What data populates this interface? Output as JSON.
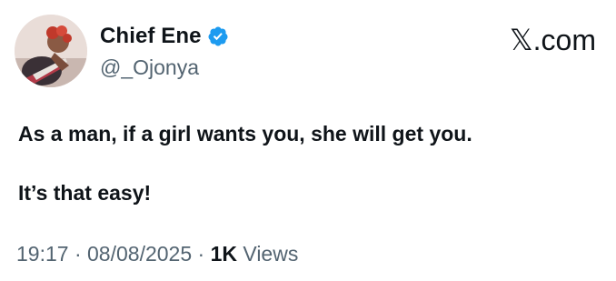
{
  "user": {
    "display_name": "Chief Ene",
    "handle": "@_Ojonya",
    "verified_icon": "verified-badge-icon",
    "avatar_icon": "avatar-photo"
  },
  "brand": {
    "label": "𝕏.com"
  },
  "tweet": {
    "line1": "As a man, if a girl wants you, she will get you.",
    "line2": "It’s that easy!"
  },
  "meta": {
    "time": "19:17",
    "sep1": " · ",
    "date": "08/08/2025",
    "sep2": " · ",
    "views_count": "1K",
    "views_label": " Views"
  },
  "colors": {
    "text": "#0f1419",
    "muted": "#536471",
    "verified": "#1d9bf0"
  }
}
